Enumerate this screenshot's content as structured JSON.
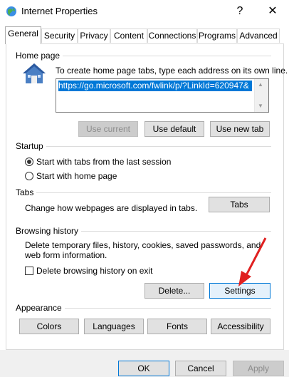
{
  "window": {
    "title": "Internet Properties",
    "help_glyph": "?",
    "close_glyph": "✕"
  },
  "tabs": [
    "General",
    "Security",
    "Privacy",
    "Content",
    "Connections",
    "Programs",
    "Advanced"
  ],
  "home_page": {
    "group_label": "Home page",
    "instruction": "To create home page tabs, type each address on its own line.",
    "url_value": "https://go.microsoft.com/fwlink/p/?LinkId=620947&",
    "buttons": {
      "use_current": "Use current",
      "use_default": "Use default",
      "use_new_tab": "Use new tab"
    }
  },
  "startup": {
    "group_label": "Startup",
    "options": [
      "Start with tabs from the last session",
      "Start with home page"
    ],
    "selected": "Start with tabs from the last session"
  },
  "tabs_group": {
    "group_label": "Tabs",
    "description": "Change how webpages are displayed in tabs.",
    "button": "Tabs"
  },
  "browsing_history": {
    "group_label": "Browsing history",
    "description": "Delete temporary files, history, cookies, saved passwords, and web form information.",
    "checkbox_label": "Delete browsing history on exit",
    "checkbox_checked": false,
    "delete_button": "Delete...",
    "settings_button": "Settings"
  },
  "appearance": {
    "group_label": "Appearance",
    "buttons": [
      "Colors",
      "Languages",
      "Fonts",
      "Accessibility"
    ]
  },
  "footer": {
    "ok": "OK",
    "cancel": "Cancel",
    "apply": "Apply"
  },
  "colors": {
    "accent_selection": "#0078d7",
    "arrow": "#e02020"
  }
}
